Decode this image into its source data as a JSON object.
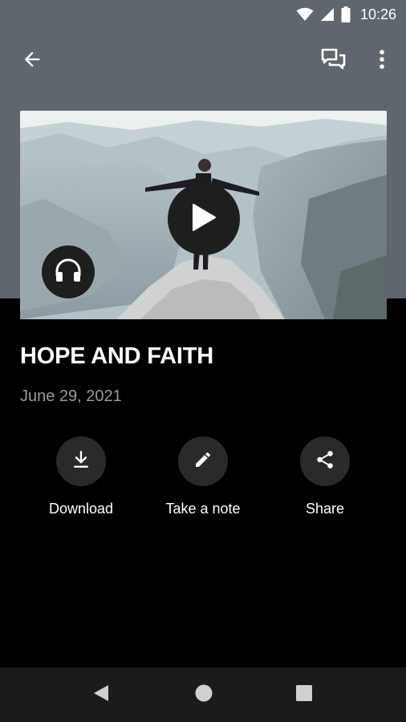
{
  "status_bar": {
    "time": "10:26",
    "icons": [
      "wifi-icon",
      "cell-signal-icon",
      "battery-icon"
    ]
  },
  "app_bar": {
    "back_icon": "arrow-left-icon",
    "chat_icon": "chat-bubbles-icon",
    "more_icon": "more-vert-icon"
  },
  "media": {
    "play_icon": "play-icon",
    "audio_icon": "headphones-icon"
  },
  "sermon": {
    "title": "HOPE AND FAITH",
    "date": "June 29, 2021"
  },
  "actions": [
    {
      "label": "Download",
      "icon": "download-icon"
    },
    {
      "label": "Take a note",
      "icon": "pencil-icon"
    },
    {
      "label": "Share",
      "icon": "share-icon"
    }
  ],
  "colors": {
    "header_bg": "#5f676d",
    "page_bg": "#000000",
    "date_text": "#9a9a9a",
    "action_circle": "#2a2a2a",
    "nav_bar": "#1b1b1b"
  },
  "nav_bar": {
    "icons": [
      "nav-back-icon",
      "nav-home-icon",
      "nav-recents-icon"
    ]
  }
}
